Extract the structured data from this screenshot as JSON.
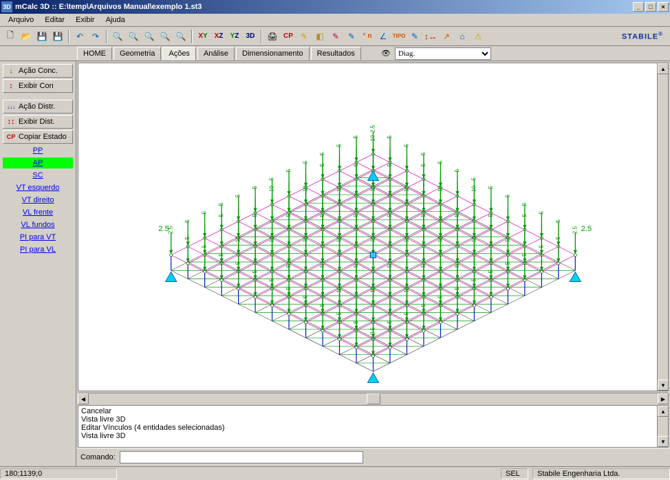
{
  "window": {
    "title": "mCalc 3D :: E:\\temp\\Arquivos Manual\\exemplo 1.st3",
    "app_icon_label": "3D"
  },
  "menus": [
    "Arquivo",
    "Editar",
    "Exibir",
    "Ajuda"
  ],
  "toolbar": {
    "new": "new-icon",
    "open": "open-icon",
    "save": "save-icon",
    "saveas": "saveas-icon",
    "undo": "undo-icon",
    "redo": "redo-icon",
    "zoomout": "zoom-out-icon",
    "prevzoom": "zoom-prev-icon",
    "zoomwin": "zoom-window-icon",
    "zoomin": "zoom-in-icon",
    "zoomall": "zoom-all-icon",
    "view_xy": "XY",
    "view_xz": "XZ",
    "view_yz": "YZ",
    "view_3d": "3D",
    "print": "print-icon",
    "cp": "CP",
    "pencil": "pencil-icon",
    "eraser": "eraser-icon",
    "mag1": "tool-a-icon",
    "mag2": "tool-b-icon",
    "degn": "° n",
    "angle": "angle-icon",
    "tipo": "TIPO",
    "edit1": "edit1-icon",
    "arrows": "arrows-icon",
    "share": "share-icon",
    "support": "support-icon",
    "warn": "warn-icon"
  },
  "brand": "STABILE",
  "tabs": [
    {
      "label": "HOME",
      "active": false
    },
    {
      "label": "Geometria",
      "active": false
    },
    {
      "label": "Ações",
      "active": true
    },
    {
      "label": "Análise",
      "active": false
    },
    {
      "label": "Dimensionamento",
      "active": false
    },
    {
      "label": "Resultados",
      "active": false
    }
  ],
  "view_select": {
    "selected": "Diag.",
    "options": [
      "Diag."
    ]
  },
  "sidebar": {
    "buttons": [
      {
        "icon": "↓",
        "icon_color": "#008000",
        "label": "Ação Conc."
      },
      {
        "icon": "↕",
        "icon_color": "#cc0000",
        "label": "Exibir Con"
      },
      {
        "icon": "↓↓↓",
        "icon_color": "#000080",
        "label": "Ação Distr."
      },
      {
        "icon": "↕↕",
        "icon_color": "#cc0000",
        "label": "Exibir Dist."
      },
      {
        "icon": "CP",
        "icon_color": "#cc0000",
        "label": "Copiar Estado"
      }
    ],
    "links": [
      {
        "label": "PP",
        "hl": false
      },
      {
        "label": "AP",
        "hl": true
      },
      {
        "label": "SC",
        "hl": false
      },
      {
        "label": "VT esquerdo",
        "hl": false
      },
      {
        "label": "VT direito",
        "hl": false
      },
      {
        "label": "VL frente",
        "hl": false
      },
      {
        "label": "VL fundos",
        "hl": false
      },
      {
        "label": "PI para VT",
        "hl": false
      },
      {
        "label": "PI para VL",
        "hl": false
      }
    ]
  },
  "load_values": {
    "edges": "2.5",
    "inner_low": "5",
    "inner_high": "10"
  },
  "log": [
    "Cancelar",
    "Vista livre 3D",
    "Editar Vínculos (4 entidades selecionadas)",
    "Vista livre 3D"
  ],
  "command": {
    "label": "Comando:",
    "value": ""
  },
  "status": {
    "coords": "180;1139;0",
    "sel": "SEL",
    "company": "Stabile Engenharia Ltda."
  }
}
